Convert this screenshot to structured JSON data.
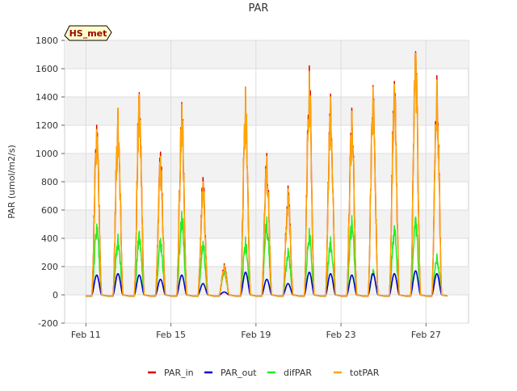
{
  "chart_data": {
    "type": "line",
    "title": "PAR",
    "xlabel": "",
    "ylabel": "PAR (umol/m2/s)",
    "badge": "HS_met",
    "x_start": "2025-02-10",
    "xlim": [
      "2025-02-10",
      "2025-02-29"
    ],
    "ylim": [
      -200,
      1800
    ],
    "yticks": [
      -200,
      0,
      200,
      400,
      600,
      800,
      1000,
      1200,
      1400,
      1600,
      1800
    ],
    "xticks": [
      {
        "date": "2025-02-11",
        "label": "Feb 11"
      },
      {
        "date": "2025-02-15",
        "label": "Feb 15"
      },
      {
        "date": "2025-02-19",
        "label": "Feb 19"
      },
      {
        "date": "2025-02-23",
        "label": "Feb 23"
      },
      {
        "date": "2025-02-27",
        "label": "Feb 27"
      }
    ],
    "grid": true,
    "legend_position": "bottom",
    "series": [
      {
        "name": "PAR_in",
        "color": "#dd0000"
      },
      {
        "name": "PAR_out",
        "color": "#0000cc"
      },
      {
        "name": "difPAR",
        "color": "#22ee22"
      },
      {
        "name": "totPAR",
        "color": "#ffa500"
      }
    ],
    "daily_peaks": [
      {
        "date": "2025-02-11",
        "PAR_in": 1200,
        "PAR_out": 140,
        "difPAR": 500,
        "totPAR": 1170
      },
      {
        "date": "2025-02-12",
        "PAR_in": 1320,
        "PAR_out": 150,
        "difPAR": 430,
        "totPAR": 1320
      },
      {
        "date": "2025-02-13",
        "PAR_in": 1430,
        "PAR_out": 140,
        "difPAR": 450,
        "totPAR": 1420
      },
      {
        "date": "2025-02-14",
        "PAR_in": 1010,
        "PAR_out": 110,
        "difPAR": 400,
        "totPAR": 980
      },
      {
        "date": "2025-02-15",
        "PAR_in": 1360,
        "PAR_out": 140,
        "difPAR": 590,
        "totPAR": 1350
      },
      {
        "date": "2025-02-16",
        "PAR_in": 830,
        "PAR_out": 80,
        "difPAR": 380,
        "totPAR": 800
      },
      {
        "date": "2025-02-17",
        "PAR_in": 220,
        "PAR_out": 20,
        "difPAR": 180,
        "totPAR": 210
      },
      {
        "date": "2025-02-18",
        "PAR_in": 1470,
        "PAR_out": 160,
        "difPAR": 410,
        "totPAR": 1470
      },
      {
        "date": "2025-02-19",
        "PAR_in": 1000,
        "PAR_out": 110,
        "difPAR": 550,
        "totPAR": 980
      },
      {
        "date": "2025-02-20",
        "PAR_in": 770,
        "PAR_out": 80,
        "difPAR": 330,
        "totPAR": 750
      },
      {
        "date": "2025-02-21",
        "PAR_in": 1620,
        "PAR_out": 160,
        "difPAR": 470,
        "totPAR": 1580
      },
      {
        "date": "2025-02-22",
        "PAR_in": 1420,
        "PAR_out": 150,
        "difPAR": 410,
        "totPAR": 1400
      },
      {
        "date": "2025-02-23",
        "PAR_in": 1320,
        "PAR_out": 140,
        "difPAR": 560,
        "totPAR": 1300
      },
      {
        "date": "2025-02-24",
        "PAR_in": 1480,
        "PAR_out": 150,
        "difPAR": 180,
        "totPAR": 1470
      },
      {
        "date": "2025-02-25",
        "PAR_in": 1510,
        "PAR_out": 150,
        "difPAR": 490,
        "totPAR": 1490
      },
      {
        "date": "2025-02-26",
        "PAR_in": 1720,
        "PAR_out": 170,
        "difPAR": 550,
        "totPAR": 1710
      },
      {
        "date": "2025-02-27",
        "PAR_in": 1550,
        "PAR_out": 150,
        "difPAR": 290,
        "totPAR": 1520
      }
    ]
  }
}
